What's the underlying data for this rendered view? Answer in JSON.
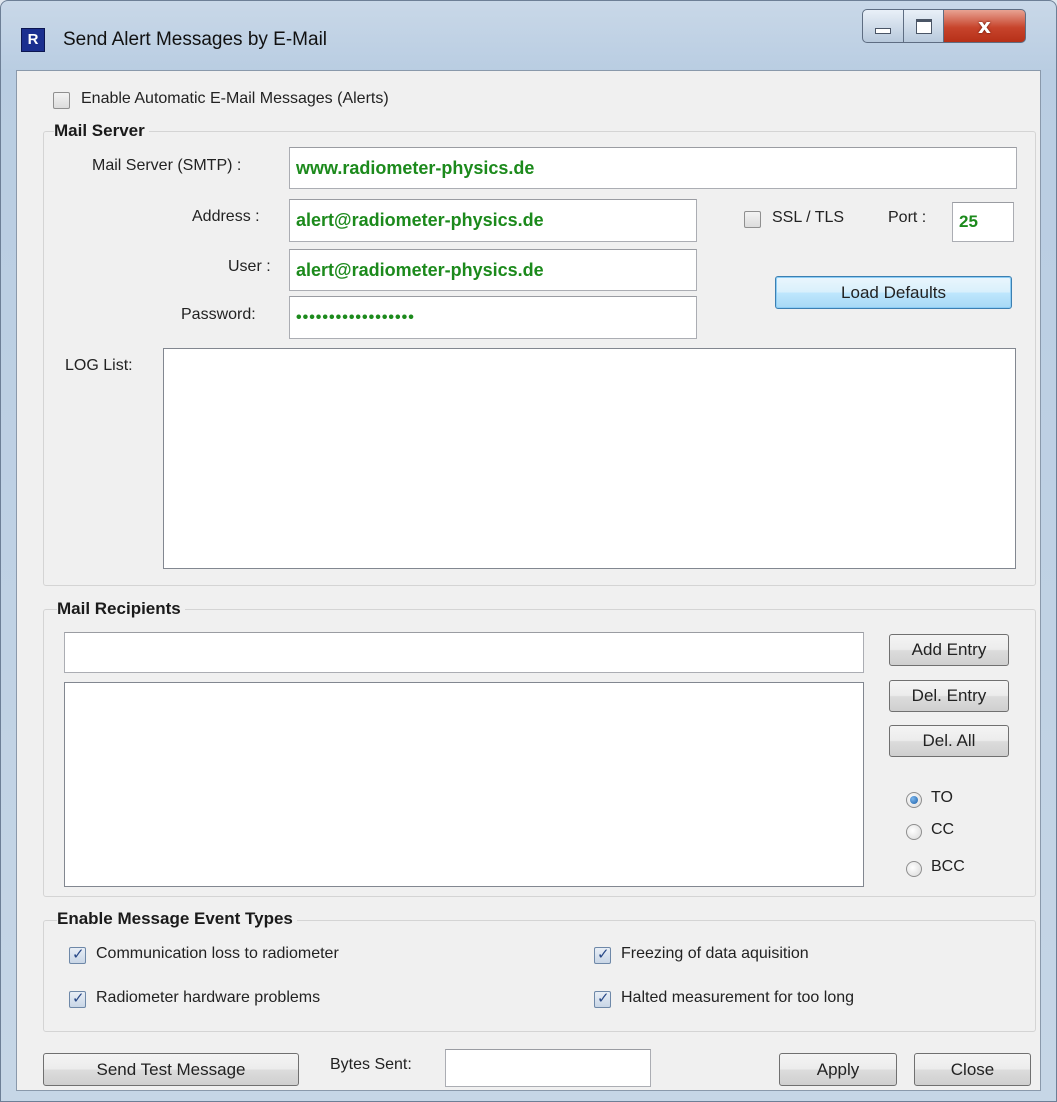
{
  "window": {
    "title": "Send Alert Messages by E-Mail",
    "close_glyph": "x",
    "icon_letter": "R"
  },
  "enable_auto": {
    "label": "Enable Automatic E-Mail Messages (Alerts)",
    "checked": false
  },
  "mail_server": {
    "group_title": "Mail Server",
    "smtp_label": "Mail Server (SMTP) :",
    "smtp_value": "www.radiometer-physics.de",
    "address_label": "Address :",
    "address_value": "alert@radiometer-physics.de",
    "user_label": "User :",
    "user_value": "alert@radiometer-physics.de",
    "password_label": "Password:",
    "password_value": "••••••••••••••••••",
    "ssl_label": "SSL / TLS",
    "ssl_checked": false,
    "port_label": "Port :",
    "port_value": "25",
    "load_defaults_label": "Load Defaults",
    "log_label": "LOG List:"
  },
  "recipients": {
    "group_title": "Mail Recipients",
    "entry_value": "",
    "add_label": "Add Entry",
    "del_label": "Del. Entry",
    "del_all_label": "Del. All",
    "radios": [
      {
        "label": "TO",
        "selected": true
      },
      {
        "label": "CC",
        "selected": false
      },
      {
        "label": "BCC",
        "selected": false
      }
    ]
  },
  "event_types": {
    "group_title": "Enable Message Event Types",
    "items": [
      {
        "label": "Communication loss to radiometer",
        "checked": true
      },
      {
        "label": "Freezing of data aquisition",
        "checked": true
      },
      {
        "label": "Radiometer hardware problems",
        "checked": true
      },
      {
        "label": "Halted measurement for too long",
        "checked": true
      }
    ]
  },
  "footer": {
    "send_test_label": "Send Test Message",
    "bytes_sent_label": "Bytes Sent:",
    "bytes_sent_value": "",
    "apply_label": "Apply",
    "close_label": "Close"
  },
  "colors": {
    "field_text": "#1c8a1c",
    "close_button": "#c7442c"
  }
}
